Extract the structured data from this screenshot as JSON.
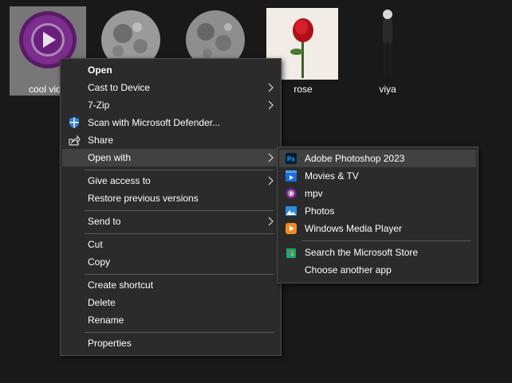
{
  "files": [
    {
      "label": "cool vid",
      "name": "cool-video"
    },
    {
      "label": "",
      "name": "moon-1"
    },
    {
      "label": "",
      "name": "moon-2"
    },
    {
      "label": "rose",
      "name": "rose"
    },
    {
      "label": "viya",
      "name": "viya"
    }
  ],
  "context_menu": {
    "open": "Open",
    "cast": "Cast to Device",
    "zip": "7-Zip",
    "defender": "Scan with Microsoft Defender...",
    "share": "Share",
    "open_with": "Open with",
    "give_access": "Give access to",
    "restore": "Restore previous versions",
    "send_to": "Send to",
    "cut": "Cut",
    "copy": "Copy",
    "create_shortcut": "Create shortcut",
    "delete": "Delete",
    "rename": "Rename",
    "properties": "Properties"
  },
  "submenu": {
    "photoshop": "Adobe Photoshop 2023",
    "movies": "Movies & TV",
    "mpv": "mpv",
    "photos": "Photos",
    "wmp": "Windows Media Player",
    "store": "Search the Microsoft Store",
    "choose": "Choose another app"
  },
  "colors": {
    "background": "#191919",
    "menu_bg": "#2b2b2b",
    "highlight": "#414141",
    "mpv_purple": "#6b1f7d"
  }
}
